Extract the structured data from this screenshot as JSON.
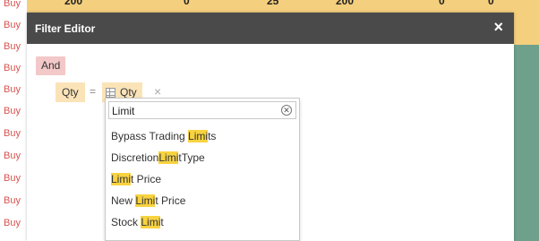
{
  "background": {
    "top_numbers": [
      "200",
      "0",
      "25",
      "200",
      "0",
      "0"
    ],
    "buy_label": "Buy",
    "buy_rows": 10
  },
  "dialog": {
    "title": "Filter Editor",
    "close_symbol": "×",
    "group_operator": "And",
    "condition": {
      "field": "Qty",
      "operator": "=",
      "value": "Qty",
      "remove_symbol": "×"
    }
  },
  "dropdown": {
    "search_value": "Limit",
    "highlight": "Limi",
    "options": [
      {
        "pre": "Bypass Trading ",
        "match": "Limi",
        "post": "ts"
      },
      {
        "pre": "Discretion",
        "match": "Limi",
        "post": "tType"
      },
      {
        "pre": "",
        "match": "Limi",
        "post": "t Price"
      },
      {
        "pre": "New ",
        "match": "Limi",
        "post": "t Price"
      },
      {
        "pre": "Stock ",
        "match": "Limi",
        "post": "t"
      }
    ]
  },
  "colors": {
    "header_bg": "#4a4a4a",
    "group_chip": "#f3c8c8",
    "field_chip": "#fbe3b8",
    "highlight": "#f8d340",
    "buy_text": "#d9534f"
  }
}
